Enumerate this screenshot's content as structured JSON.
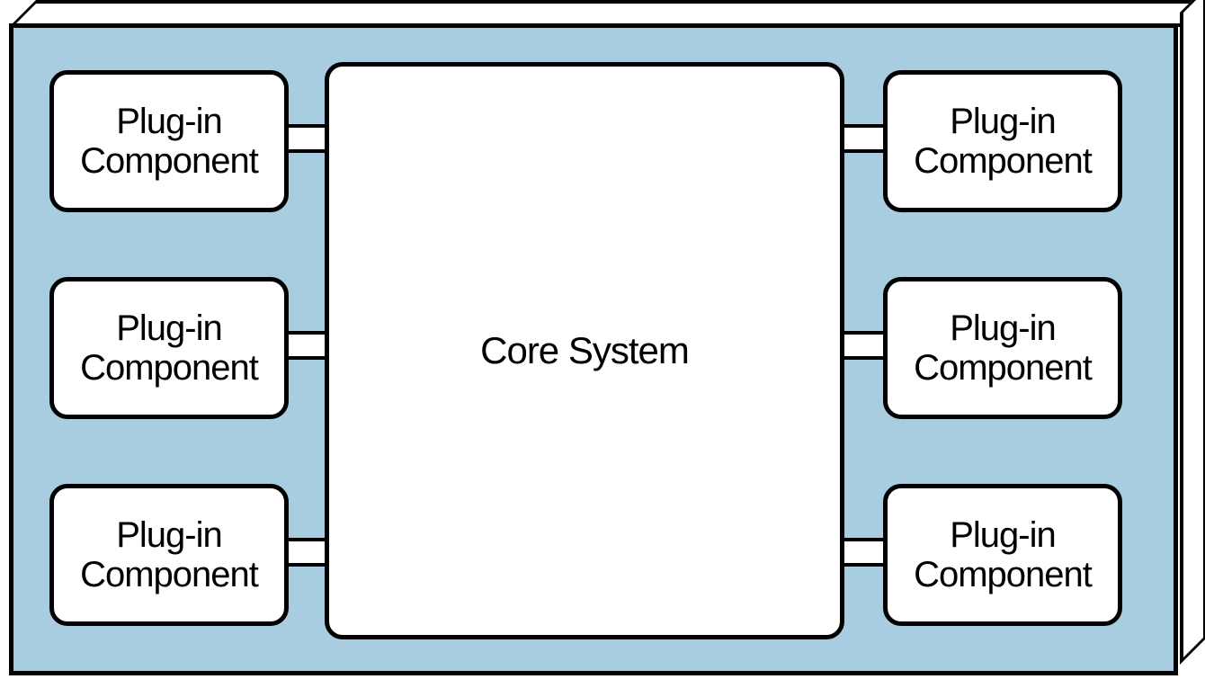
{
  "diagram": {
    "core_system_label": "Core System",
    "plugins": {
      "left": [
        {
          "line1": "Plug-in",
          "line2": "Component"
        },
        {
          "line1": "Plug-in",
          "line2": "Component"
        },
        {
          "line1": "Plug-in",
          "line2": "Component"
        }
      ],
      "right": [
        {
          "line1": "Plug-in",
          "line2": "Component"
        },
        {
          "line1": "Plug-in",
          "line2": "Component"
        },
        {
          "line1": "Plug-in",
          "line2": "Component"
        }
      ]
    },
    "colors": {
      "background": "#a8cce0",
      "border": "#000000",
      "box_fill": "#ffffff"
    }
  }
}
